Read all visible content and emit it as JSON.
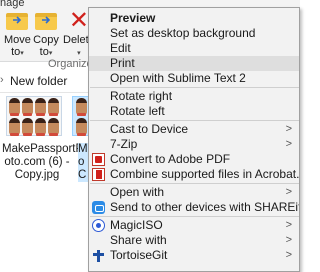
{
  "ribbon": {
    "title_fragment": "nage",
    "move_to_label": "Move",
    "move_to_label2": "to",
    "copy_to_label": "Copy",
    "copy_to_label2": "to",
    "delete_label": "Delete",
    "group_label": "Organize",
    "dropdown_arrow": "▾"
  },
  "address": {
    "chevron": "›",
    "crumb": "New folder"
  },
  "files": [
    {
      "name_lines": [
        "MakePassportPh",
        "oto.com (6) -",
        "Copy.jpg"
      ]
    },
    {
      "name_lines": [
        "Ma",
        "o",
        "C"
      ]
    }
  ],
  "context_menu": {
    "items": [
      {
        "label": "Preview",
        "bold": true
      },
      {
        "label": "Set as desktop background"
      },
      {
        "label": "Edit"
      },
      {
        "label": "Print",
        "highlighted": true
      },
      {
        "label": "Open with Sublime Text 2"
      },
      {
        "label": "Rotate right"
      },
      {
        "label": "Rotate left"
      },
      {
        "label": "Cast to Device",
        "submenu": true
      },
      {
        "label": "7-Zip",
        "submenu": true
      },
      {
        "label": "Convert to Adobe PDF",
        "icon": "adobe-pdf-icon"
      },
      {
        "label": "Combine supported files in Acrobat...",
        "icon": "acrobat-combine-icon"
      },
      {
        "label": "Open with",
        "submenu": true
      },
      {
        "label": "Send to other devices with SHAREit",
        "icon": "shareit-icon"
      },
      {
        "label": "MagicISO",
        "submenu": true,
        "icon": "magiciso-icon"
      },
      {
        "label": "Share with",
        "submenu": true
      },
      {
        "label": "TortoiseGit",
        "submenu": true,
        "icon": "tortoisegit-icon"
      }
    ],
    "submenu_glyph": ">"
  },
  "colors": {
    "menu_bg": "#f2f2f2",
    "highlight": "#dedede",
    "selection": "#cce8ff"
  }
}
